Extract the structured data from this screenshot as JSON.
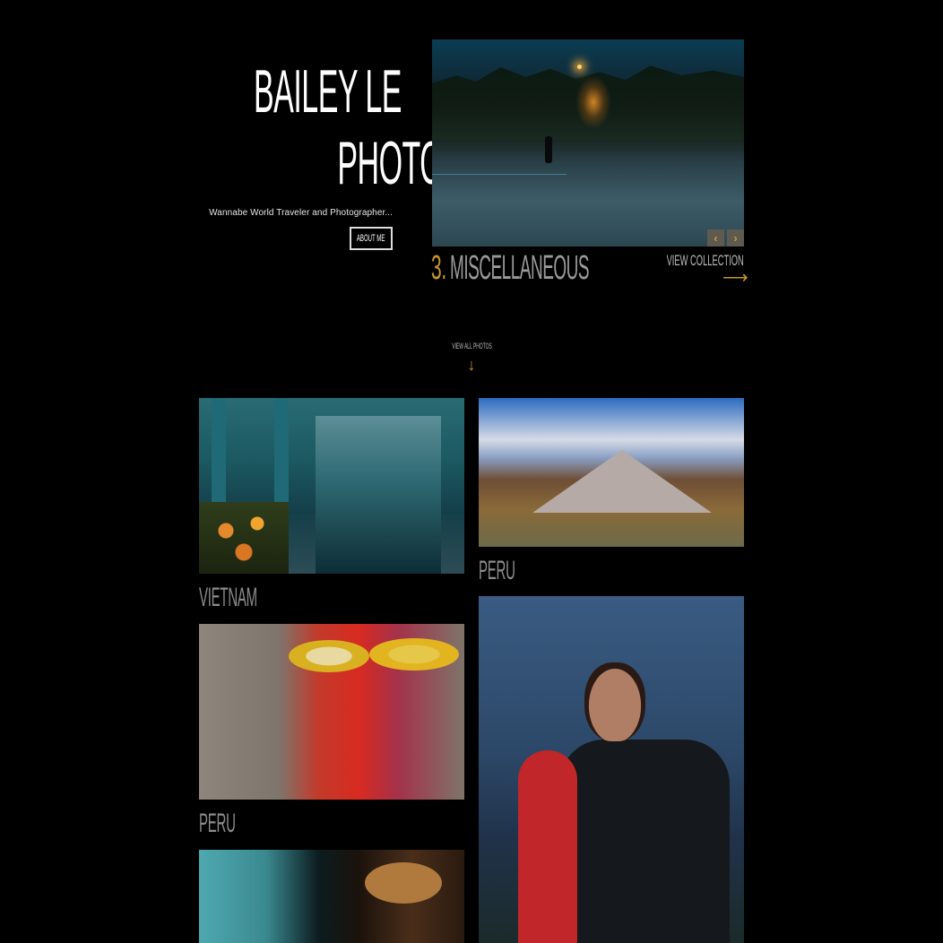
{
  "header": {
    "title_line1": "BAILEY LE",
    "title_line2": "PHOTOGRAPHY",
    "tagline": "Wannabe World Traveler and Photographer...",
    "about_label": "ABOUT ME"
  },
  "featured": {
    "number": "3.",
    "name": "MISCELLANEOUS",
    "view_collection_label": "VIEW COLLECTION",
    "prev_icon": "chevron-left-icon",
    "next_icon": "chevron-right-icon",
    "arrow_icon": "arrow-right-icon"
  },
  "view_all": {
    "label": "VIEW ALL PHOTOS",
    "arrow_icon": "arrow-down-icon"
  },
  "gallery": [
    {
      "caption": "VIETNAM"
    },
    {
      "caption": "PERU"
    },
    {
      "caption": "PERU"
    }
  ],
  "colors": {
    "background": "#000000",
    "accent": "#c8962e",
    "caption": "#8c8c8c"
  }
}
